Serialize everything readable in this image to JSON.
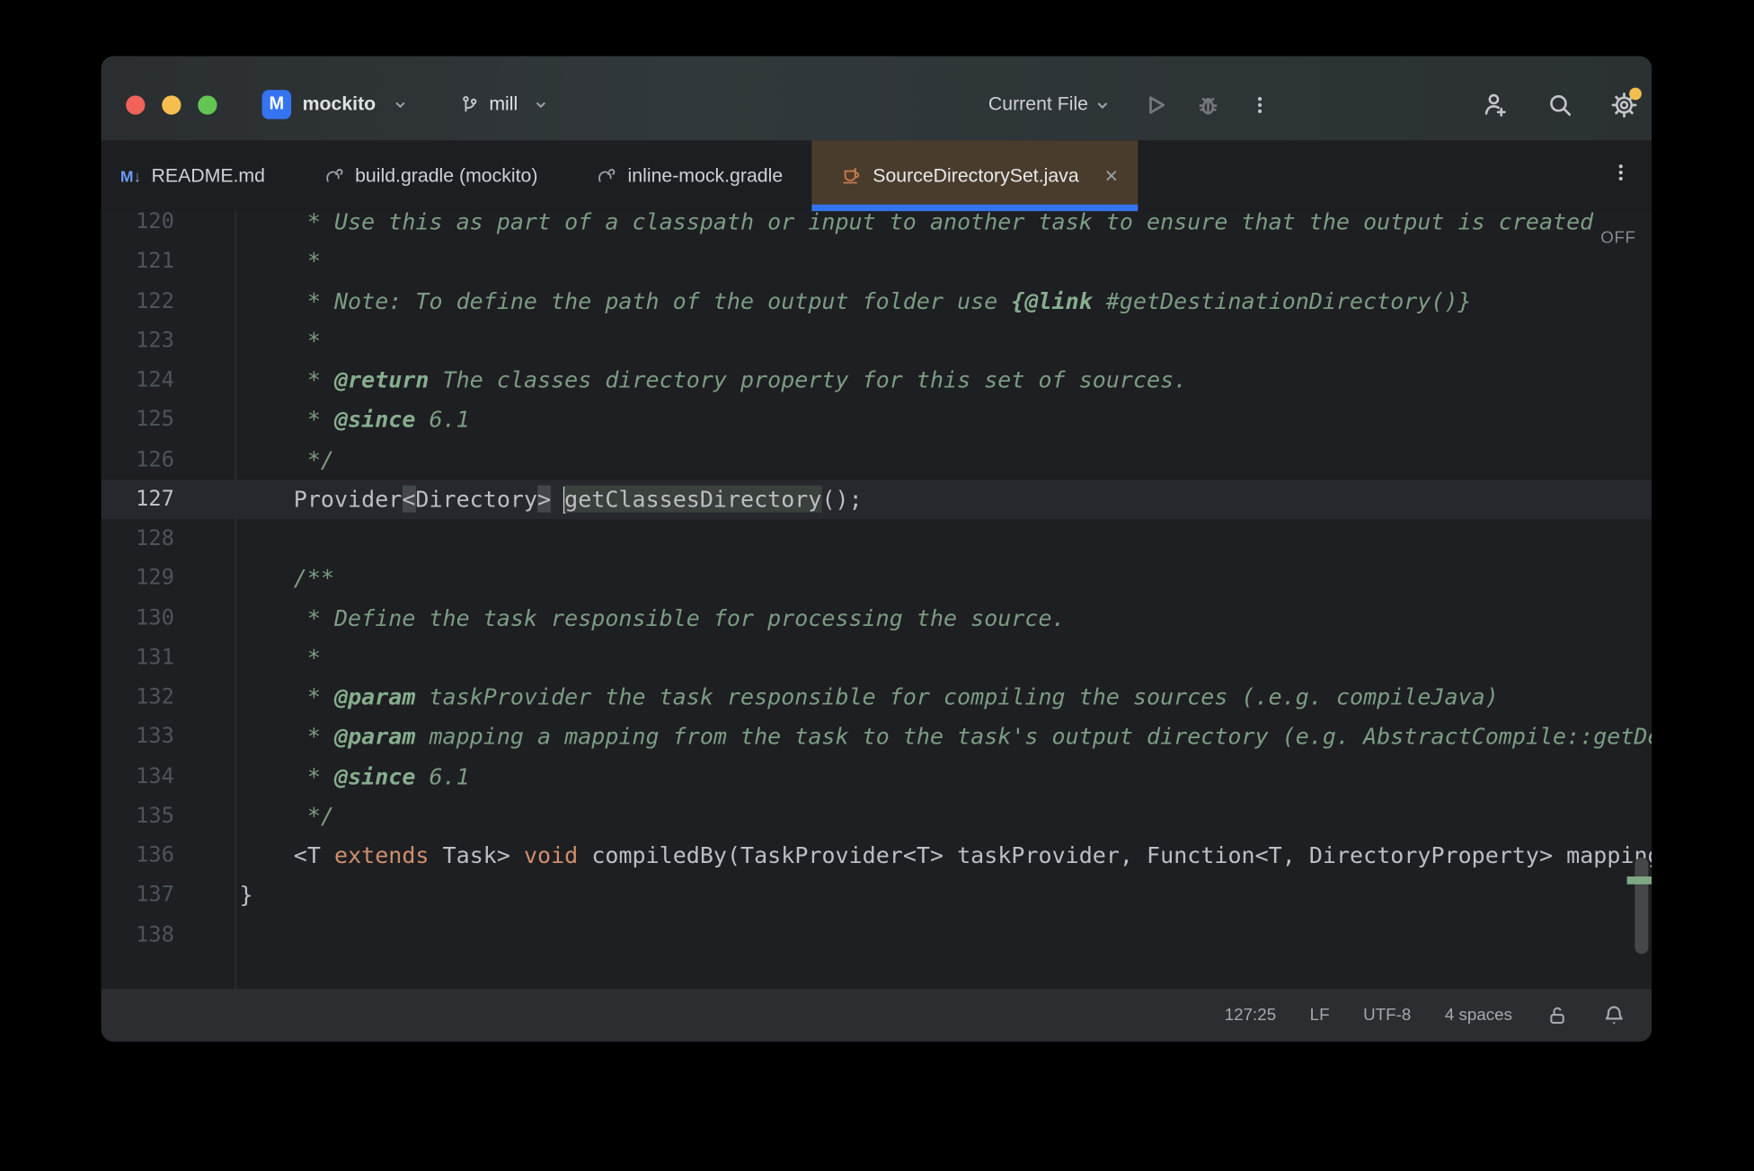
{
  "colors": {
    "accent_blue": "#3574F0",
    "active_tab_bg": "#4A3C2C",
    "traffic_red": "#F0625A",
    "traffic_yellow": "#F6BE4F",
    "traffic_green": "#62C554",
    "gear_badge": "#F2BE4E",
    "doc_comment_green": "#7C9C84",
    "keyword_orange": "#CF8E6D"
  },
  "icons": {
    "markdown-icon": "M↓",
    "gradle-icon": "elephant",
    "java-icon": "coffee-cup",
    "close-icon": "×"
  },
  "titlebar": {
    "project_badge": "M",
    "project_name": "mockito",
    "branch_name": "mill",
    "run_config": "Current File"
  },
  "tabs": [
    {
      "label": "README.md",
      "icon": "markdown-icon",
      "active": false
    },
    {
      "label": "build.gradle (mockito)",
      "icon": "gradle-icon",
      "active": false
    },
    {
      "label": "inline-mock.gradle",
      "icon": "gradle-icon",
      "active": false
    },
    {
      "label": "SourceDirectorySet.java",
      "icon": "java-icon",
      "active": true,
      "close": "×"
    }
  ],
  "editor": {
    "off_label": "OFF",
    "current_line": 127,
    "caret_position": "127:25",
    "lines": [
      {
        "n": 120,
        "segs": [
          {
            "c": "d",
            "t": "     * Use this as part of a classpath or input to another task to ensure that the output is created"
          }
        ]
      },
      {
        "n": 121,
        "segs": [
          {
            "c": "d",
            "t": "     *"
          }
        ]
      },
      {
        "n": 122,
        "segs": [
          {
            "c": "d",
            "t": "     * Note: To define the path of the output folder use "
          },
          {
            "c": "g",
            "t": "{@link"
          },
          {
            "c": "d",
            "t": " #getDestinationDirectory()}"
          }
        ]
      },
      {
        "n": 123,
        "segs": [
          {
            "c": "d",
            "t": "     *"
          }
        ]
      },
      {
        "n": 124,
        "segs": [
          {
            "c": "d",
            "t": "     * "
          },
          {
            "c": "g",
            "t": "@return"
          },
          {
            "c": "d",
            "t": " The classes directory property for this set of sources."
          }
        ]
      },
      {
        "n": 125,
        "segs": [
          {
            "c": "d",
            "t": "     * "
          },
          {
            "c": "g",
            "t": "@since"
          },
          {
            "c": "d",
            "t": " 6.1"
          }
        ]
      },
      {
        "n": 126,
        "segs": [
          {
            "c": "d",
            "t": "     */"
          }
        ]
      },
      {
        "n": 127,
        "segs": [
          {
            "c": "c",
            "t": "    Provider"
          },
          {
            "c": "hb",
            "t": "<"
          },
          {
            "c": "c",
            "t": "Directory"
          },
          {
            "c": "hb",
            "t": ">"
          },
          {
            "c": "c",
            "t": " "
          },
          {
            "caret": true
          },
          {
            "c": "hi",
            "t": "getClassesDirectory"
          },
          {
            "c": "c",
            "t": "();"
          }
        ]
      },
      {
        "n": 128,
        "segs": []
      },
      {
        "n": 129,
        "segs": [
          {
            "c": "d",
            "t": "    /**"
          }
        ]
      },
      {
        "n": 130,
        "segs": [
          {
            "c": "d",
            "t": "     * Define the task responsible for processing the source."
          }
        ]
      },
      {
        "n": 131,
        "segs": [
          {
            "c": "d",
            "t": "     *"
          }
        ]
      },
      {
        "n": 132,
        "segs": [
          {
            "c": "d",
            "t": "     * "
          },
          {
            "c": "g",
            "t": "@param"
          },
          {
            "c": "d",
            "t": " taskProvider the task responsible for compiling the sources (.e.g. compileJava)"
          }
        ]
      },
      {
        "n": 133,
        "segs": [
          {
            "c": "d",
            "t": "     * "
          },
          {
            "c": "g",
            "t": "@param"
          },
          {
            "c": "d",
            "t": " mapping a mapping from the task to the task's output directory (e.g. AbstractCompile::getDestinationDirectory)"
          }
        ]
      },
      {
        "n": 134,
        "segs": [
          {
            "c": "d",
            "t": "     * "
          },
          {
            "c": "g",
            "t": "@since"
          },
          {
            "c": "d",
            "t": " 6.1"
          }
        ]
      },
      {
        "n": 135,
        "segs": [
          {
            "c": "d",
            "t": "     */"
          }
        ]
      },
      {
        "n": 136,
        "segs": [
          {
            "c": "c",
            "t": "    <T "
          },
          {
            "c": "k",
            "t": "extends"
          },
          {
            "c": "c",
            "t": " Task> "
          },
          {
            "c": "k",
            "t": "void"
          },
          {
            "c": "c",
            "t": " compiledBy(TaskProvider<T> taskProvider, Function<T, DirectoryProperty> mapping);"
          }
        ]
      },
      {
        "n": 137,
        "segs": [
          {
            "c": "c",
            "t": "}"
          }
        ]
      },
      {
        "n": 138,
        "segs": []
      }
    ]
  },
  "statusbar": {
    "items": [
      "127:25",
      "LF",
      "UTF-8",
      "4 spaces"
    ]
  }
}
